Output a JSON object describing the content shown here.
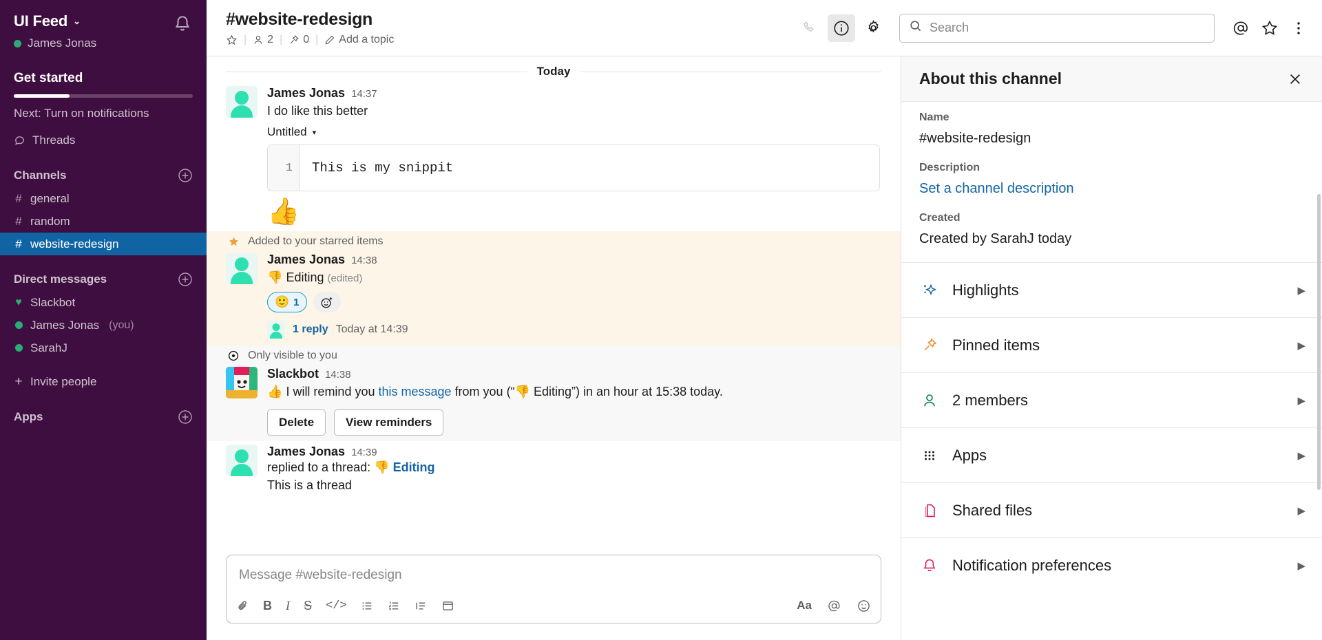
{
  "sidebar": {
    "workspace_name": "UI Feed",
    "user_name": "James Jonas",
    "notifications_icon": "bell-icon",
    "get_started": {
      "title": "Get started",
      "next_label": "Next: Turn on notifications",
      "progress_percent": 31
    },
    "threads_label": "Threads",
    "channels_section": "Channels",
    "channels": [
      {
        "name": "general",
        "active": false
      },
      {
        "name": "random",
        "active": false
      },
      {
        "name": "website-redesign",
        "active": true
      }
    ],
    "dms_section": "Direct messages",
    "dms": [
      {
        "name": "Slackbot",
        "suffix": "",
        "presence": "heart"
      },
      {
        "name": "James Jonas",
        "suffix": "(you)",
        "presence": "online"
      },
      {
        "name": "SarahJ",
        "suffix": "",
        "presence": "online"
      }
    ],
    "invite_label": "Invite people",
    "apps_section": "Apps"
  },
  "topbar": {
    "channel_title": "#website-redesign",
    "star_icon": "star-icon",
    "members_count": "2",
    "pins_count": "0",
    "topic_label": "Add a topic",
    "call_icon": "phone-icon",
    "info_icon": "info-icon",
    "settings_icon": "gear-icon",
    "mentions_icon": "at-icon",
    "saved_icon": "star-outline-icon",
    "more_icon": "more-vertical-icon"
  },
  "search": {
    "placeholder": "Search",
    "value": "",
    "icon": "search-icon"
  },
  "messages": {
    "day_divider": "Today",
    "items": [
      {
        "type": "message",
        "author": "James Jonas",
        "time": "14:37",
        "text": "I do like this better"
      },
      {
        "type": "snippet",
        "title": "Untitled",
        "line_number": "1",
        "code": "This is my snippit"
      },
      {
        "type": "big_emoji",
        "emoji": "👍"
      },
      {
        "type": "context",
        "icon": "star-filled-icon",
        "text": "Added to your starred items"
      },
      {
        "type": "message",
        "author": "James Jonas",
        "time": "14:38",
        "emoji": "👎",
        "text": "Editing",
        "edited_label": "(edited)",
        "reactions": [
          {
            "emoji": "🙂",
            "count": "1"
          }
        ],
        "add_reaction_icon": "add-reaction-icon",
        "reply_count": "1 reply",
        "reply_time": "Today at 14:39"
      },
      {
        "type": "context",
        "icon": "eye-icon",
        "text": "Only visible to you"
      },
      {
        "type": "bot_message",
        "author": "Slackbot",
        "time": "14:38",
        "emoji": "👍",
        "text_before": "I will remind you ",
        "link_text": "this message",
        "text_after": " from you (“👎 Editing”) in an hour at 15:38 today.",
        "buttons": [
          "Delete",
          "View reminders"
        ]
      },
      {
        "type": "message",
        "author": "James Jonas",
        "time": "14:39",
        "thread_prefix": "replied to a thread:",
        "thread_emoji": "👎",
        "thread_link": "Editing",
        "body": "This is a thread"
      }
    ]
  },
  "composer": {
    "placeholder": "Message #website-redesign",
    "tools_left": [
      "attachment-icon",
      "bold-icon",
      "italic-icon",
      "strikethrough-icon",
      "code-icon",
      "bulleted-list-icon",
      "numbered-list-icon",
      "blockquote-icon",
      "code-block-icon"
    ],
    "tools_right": [
      "formatting-icon",
      "mention-icon",
      "emoji-icon"
    ]
  },
  "right_panel": {
    "title": "About this channel",
    "close_icon": "close-icon",
    "fields": [
      {
        "label": "Name",
        "value": "#website-redesign",
        "is_link": false
      },
      {
        "label": "Description",
        "value": "Set a channel description",
        "is_link": true
      },
      {
        "label": "Created",
        "value": "Created by SarahJ today",
        "is_link": false
      }
    ],
    "items": [
      {
        "label": "Highlights",
        "icon": "sparkles-icon",
        "color": "#1264A3"
      },
      {
        "label": "Pinned items",
        "icon": "pin-icon",
        "color": "#E8912D"
      },
      {
        "label": "2 members",
        "icon": "member-icon",
        "color": "#007A5A"
      },
      {
        "label": "Apps",
        "icon": "grid-icon",
        "color": "#1D1C1D"
      },
      {
        "label": "Shared files",
        "icon": "files-icon",
        "color": "#E01E5A"
      },
      {
        "label": "Notification preferences",
        "icon": "bell-icon",
        "color": "#E01E5A"
      }
    ],
    "arrow": "▶"
  },
  "colors": {
    "sidebar_bg": "#3F0E40",
    "active_channel": "#1164A3",
    "link": "#1264A3",
    "highlight_bg": "#FDF5E8",
    "ephemeral_bg": "#F8F8F8",
    "presence_green": "#2BAC76"
  }
}
